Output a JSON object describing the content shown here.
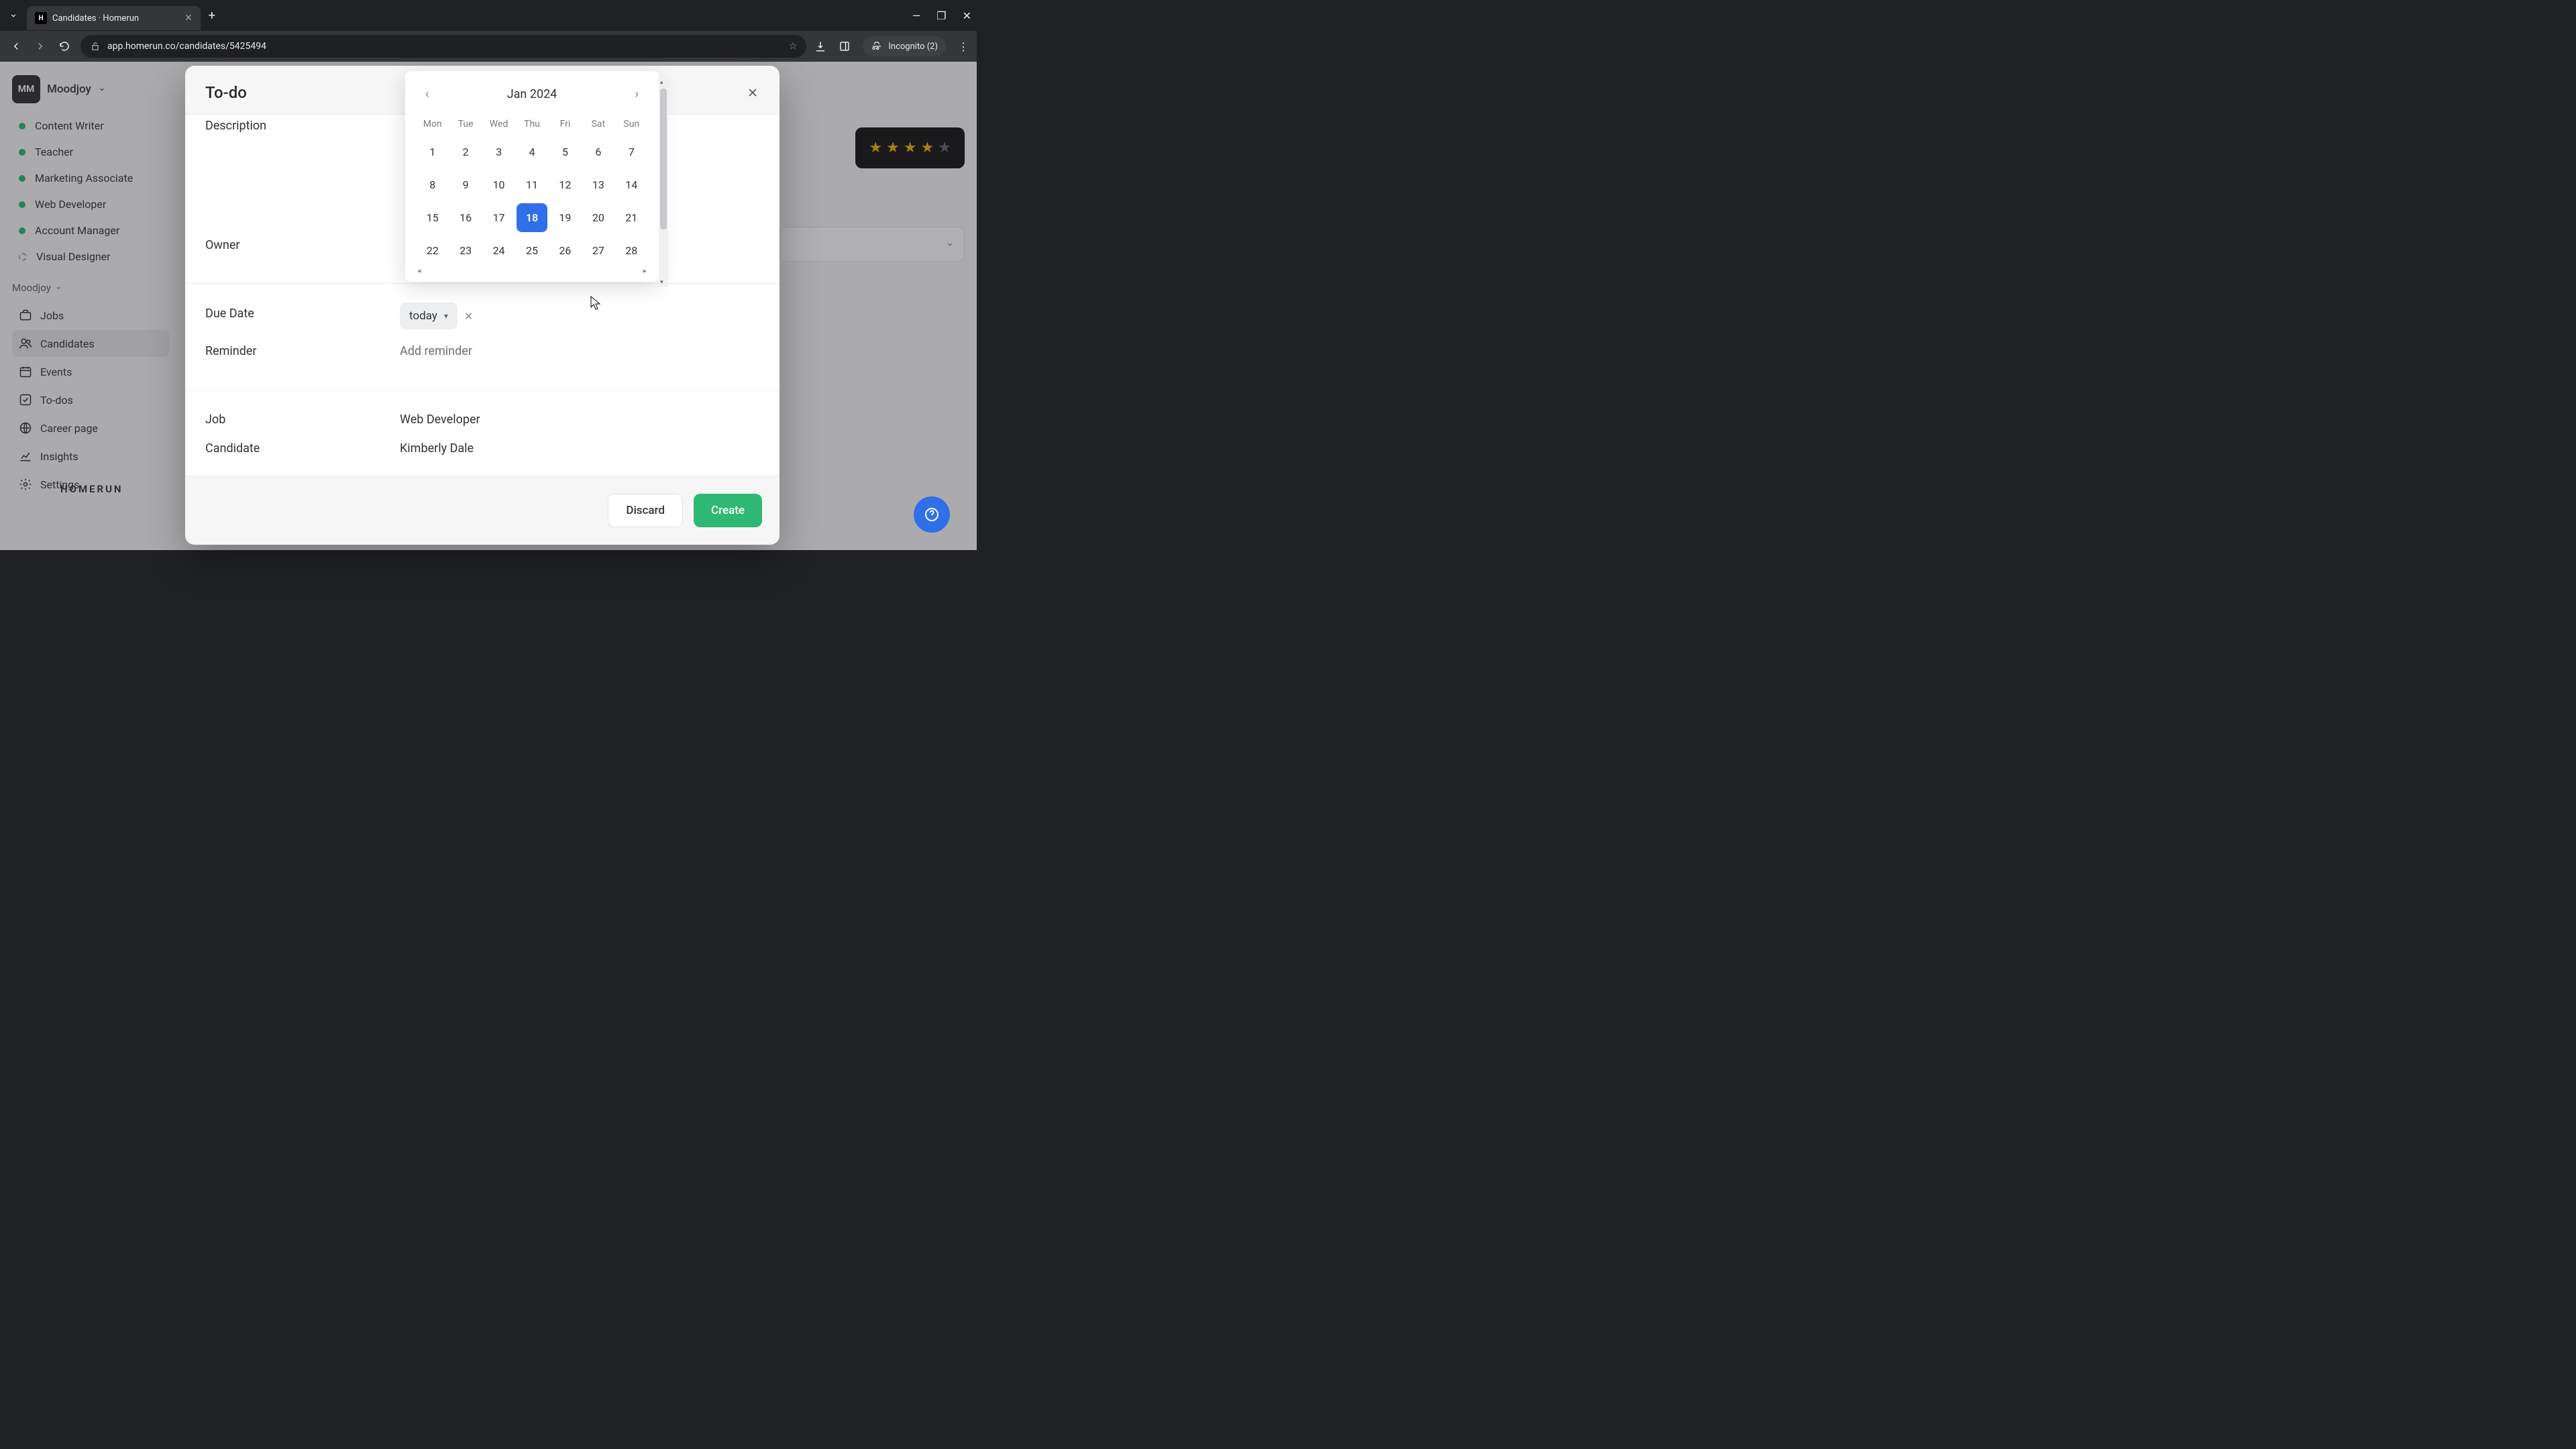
{
  "browser": {
    "tab_title": "Candidates · Homerun",
    "favicon_text": "H",
    "url": "app.homerun.co/candidates/5425494",
    "incognito_label": "Incognito (2)"
  },
  "sidebar": {
    "workspace_avatar": "MM",
    "workspace_name": "Moodjoy",
    "jobs": [
      {
        "label": "Content Writer",
        "active": true
      },
      {
        "label": "Teacher",
        "active": true
      },
      {
        "label": "Marketing Associate",
        "active": true
      },
      {
        "label": "Web Developer",
        "active": true
      },
      {
        "label": "Account Manager",
        "active": true
      },
      {
        "label": "Visual Designer",
        "active": false
      }
    ],
    "section_label": "Moodjoy",
    "nav": {
      "jobs": "Jobs",
      "candidates": "Candidates",
      "events": "Events",
      "todos": "To-dos",
      "career_page": "Career page",
      "insights": "Insights",
      "settings": "Settings"
    },
    "brand": "HOMERUN"
  },
  "modal": {
    "title": "To-do",
    "labels": {
      "description": "Description",
      "owner": "Owner",
      "due_date": "Due Date",
      "reminder": "Reminder",
      "job": "Job",
      "candidate": "Candidate"
    },
    "values": {
      "due_date_chip": "today",
      "reminder_placeholder": "Add reminder",
      "job": "Web Developer",
      "candidate": "Kimberly Dale"
    },
    "buttons": {
      "discard": "Discard",
      "create": "Create"
    }
  },
  "datepicker": {
    "month_label": "Jan 2024",
    "dow": [
      "Mon",
      "Tue",
      "Wed",
      "Thu",
      "Fri",
      "Sat",
      "Sun"
    ],
    "days": [
      1,
      2,
      3,
      4,
      5,
      6,
      7,
      8,
      9,
      10,
      11,
      12,
      13,
      14,
      15,
      16,
      17,
      18,
      19,
      20,
      21,
      22,
      23,
      24,
      25,
      26,
      27,
      28
    ],
    "selected_day": 18
  }
}
